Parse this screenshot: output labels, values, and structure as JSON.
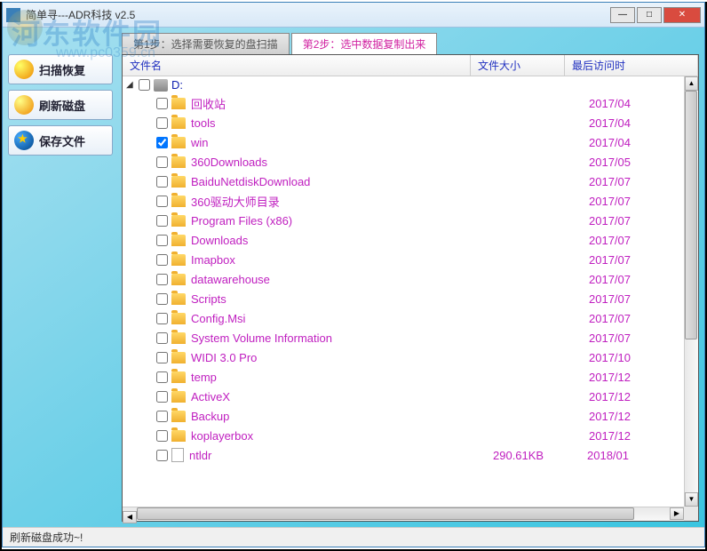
{
  "window": {
    "title": "简单寻---ADR科技 v2.5"
  },
  "watermark": {
    "main": "河东软件园",
    "sub": "www.pc0359.cn"
  },
  "sidebar": {
    "scan_label": "扫描恢复",
    "refresh_label": "刷新磁盘",
    "save_label": "保存文件"
  },
  "tabs": {
    "step1": "第1步：选择需要恢复的盘扫描",
    "step2": "第2步：选中数据复制出来"
  },
  "columns": {
    "name": "文件名",
    "size": "文件大小",
    "date": "最后访问时"
  },
  "drive": {
    "name": "D:"
  },
  "files": [
    {
      "name": "回收站",
      "type": "folder",
      "checked": false,
      "size": "",
      "date": "2017/04"
    },
    {
      "name": "tools",
      "type": "folder",
      "checked": false,
      "size": "",
      "date": "2017/04"
    },
    {
      "name": "win",
      "type": "folder",
      "checked": true,
      "size": "",
      "date": "2017/04"
    },
    {
      "name": "360Downloads",
      "type": "folder",
      "checked": false,
      "size": "",
      "date": "2017/05"
    },
    {
      "name": "BaiduNetdiskDownload",
      "type": "folder",
      "checked": false,
      "size": "",
      "date": "2017/07"
    },
    {
      "name": "360驱动大师目录",
      "type": "folder",
      "checked": false,
      "size": "",
      "date": "2017/07"
    },
    {
      "name": "Program Files (x86)",
      "type": "folder",
      "checked": false,
      "size": "",
      "date": "2017/07"
    },
    {
      "name": "Downloads",
      "type": "folder",
      "checked": false,
      "size": "",
      "date": "2017/07"
    },
    {
      "name": "Imapbox",
      "type": "folder",
      "checked": false,
      "size": "",
      "date": "2017/07"
    },
    {
      "name": "datawarehouse",
      "type": "folder",
      "checked": false,
      "size": "",
      "date": "2017/07"
    },
    {
      "name": "Scripts",
      "type": "folder",
      "checked": false,
      "size": "",
      "date": "2017/07"
    },
    {
      "name": "Config.Msi",
      "type": "folder",
      "checked": false,
      "size": "",
      "date": "2017/07"
    },
    {
      "name": "System Volume Information",
      "type": "folder",
      "checked": false,
      "size": "",
      "date": "2017/07"
    },
    {
      "name": "WIDI 3.0 Pro",
      "type": "folder",
      "checked": false,
      "size": "",
      "date": "2017/10"
    },
    {
      "name": "temp",
      "type": "folder",
      "checked": false,
      "size": "",
      "date": "2017/12"
    },
    {
      "name": "ActiveX",
      "type": "folder",
      "checked": false,
      "size": "",
      "date": "2017/12"
    },
    {
      "name": "Backup",
      "type": "folder",
      "checked": false,
      "size": "",
      "date": "2017/12"
    },
    {
      "name": "koplayerbox",
      "type": "folder",
      "checked": false,
      "size": "",
      "date": "2017/12"
    },
    {
      "name": "ntldr",
      "type": "file",
      "checked": false,
      "size": "290.61KB",
      "date": "2018/01"
    }
  ],
  "status": {
    "text": "刷新磁盘成功~!"
  }
}
